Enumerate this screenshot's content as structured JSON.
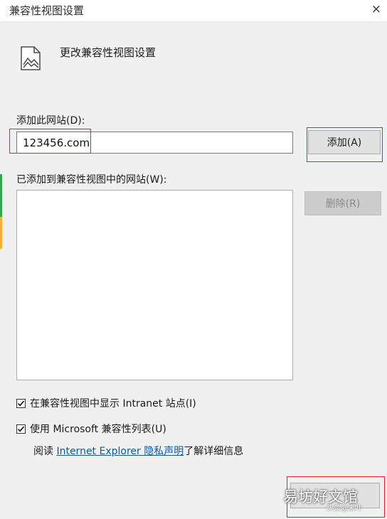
{
  "window": {
    "title": "兼容性视图设置",
    "close_glyph": "×"
  },
  "header": {
    "title": "更改兼容性视图设置",
    "icon": "picture-icon"
  },
  "add_site": {
    "label": "添加此网站(D):",
    "value": "123456.com",
    "add_button": "添加(A)"
  },
  "added_sites": {
    "label": "已添加到兼容性视图中的网站(W):",
    "items": [],
    "remove_button": "删除(R)"
  },
  "options": {
    "intranet": {
      "label": "在兼容性视图中显示 Intranet 站点(I)",
      "checked": true
    },
    "ms_list": {
      "label": "使用 Microsoft 兼容性列表(U)",
      "checked": true
    }
  },
  "info": {
    "prefix": "阅读 ",
    "link_text": "Internet Explorer 隐私声明",
    "suffix": "了解详细信息"
  },
  "bottom_button": {
    "label": ""
  },
  "watermark": {
    "main": "易坊好文馆",
    "sub": "头条@未叶"
  },
  "colors": {
    "annotation_red": "#e0242b",
    "link_blue": "#0b5aa8",
    "dialog_bg": "#f0f0f0"
  }
}
